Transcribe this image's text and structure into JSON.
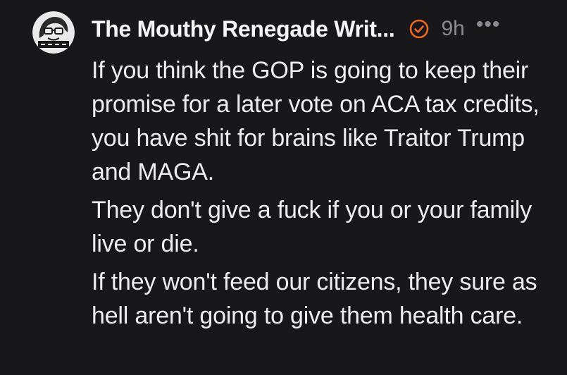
{
  "post": {
    "author": "The Mouthy Renegade Writ...",
    "time": "9h",
    "more_label": "•••",
    "badge_icon": "verified-check-icon",
    "badge_color": "#f26722",
    "avatar_icon": "cartoon-avatar-icon",
    "paragraphs": [
      "If you think the GOP is going to keep their promise for a later vote on ACA tax credits, you have shit for brains like Traitor Trump and MAGA.",
      "They don't give a fuck if you or your family live or die.",
      "If they won't feed our citizens, they sure as hell aren't going to give them health care."
    ]
  }
}
